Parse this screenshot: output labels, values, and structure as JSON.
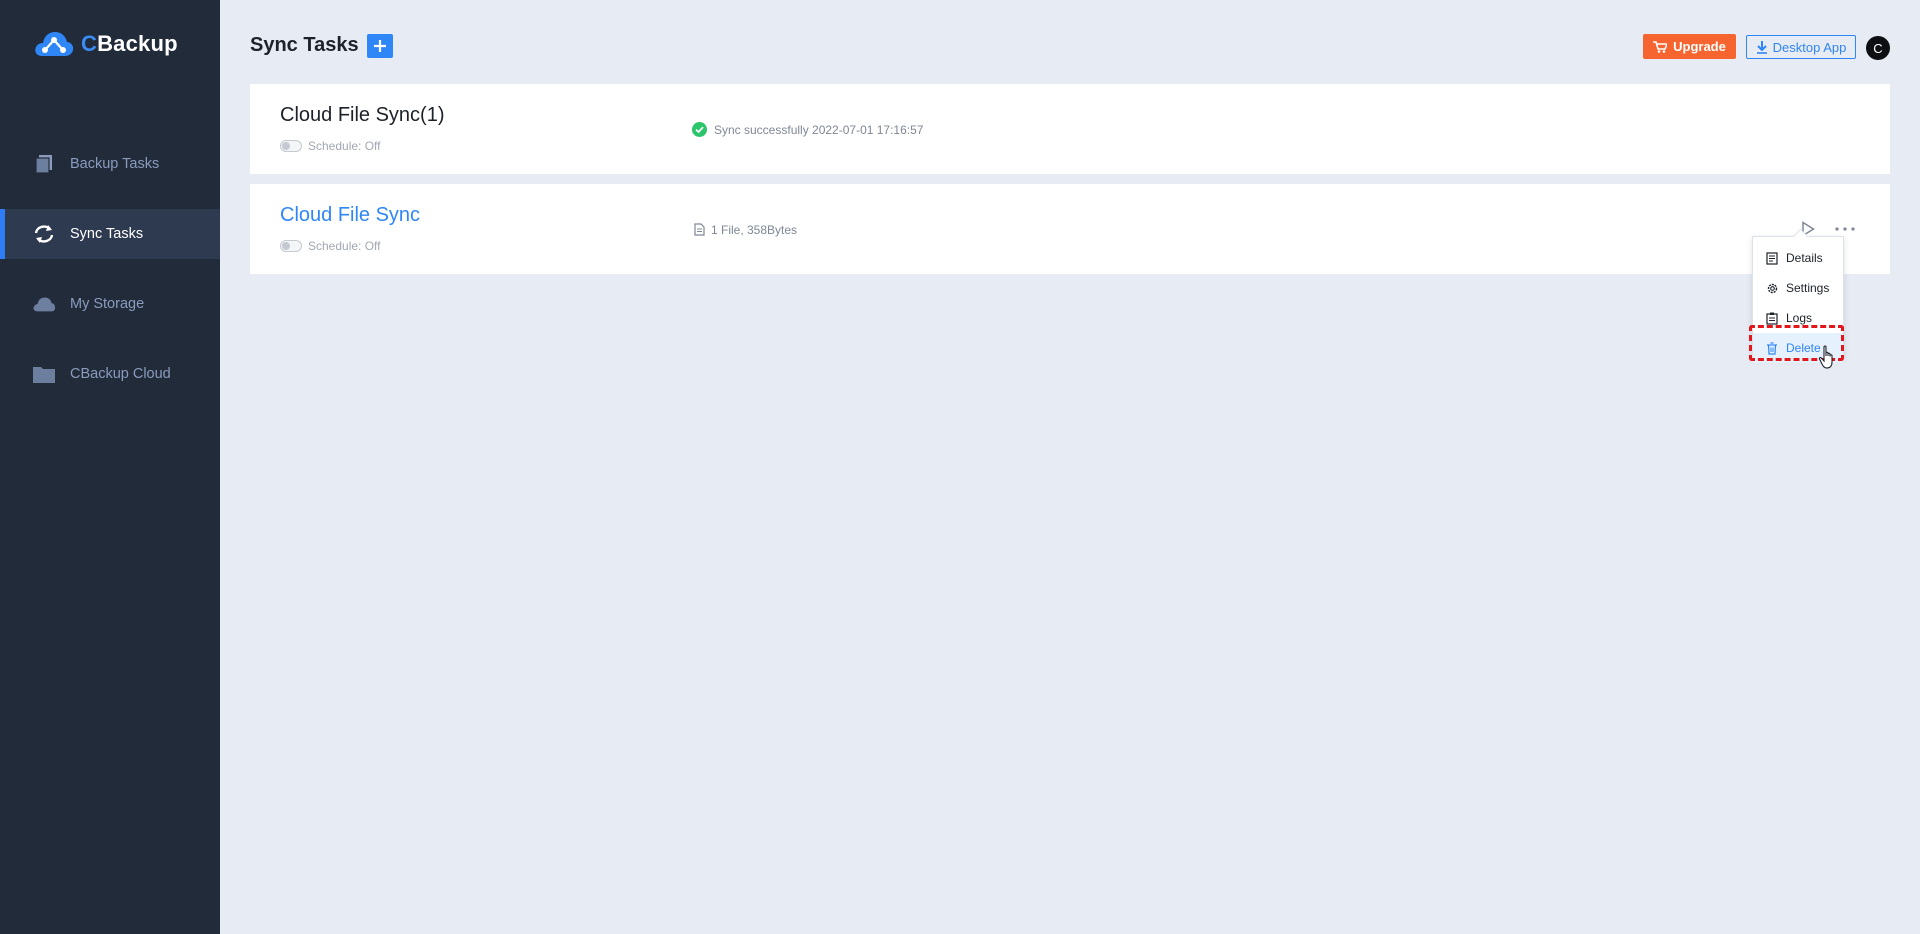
{
  "app": {
    "logo_initial": "C",
    "logo_rest": "Backup"
  },
  "sidebar": {
    "items": [
      {
        "label": "Backup Tasks",
        "icon": "backup-tasks-icon"
      },
      {
        "label": "Sync Tasks",
        "icon": "sync-icon",
        "active": true
      },
      {
        "label": "My Storage",
        "icon": "cloud-icon"
      },
      {
        "label": "CBackup Cloud",
        "icon": "folder-icon"
      }
    ]
  },
  "header": {
    "title": "Sync Tasks",
    "upgrade_label": "Upgrade",
    "desktop_app_label": "Desktop App",
    "avatar_initial": "C"
  },
  "tasks": [
    {
      "name": "Cloud File Sync(1)",
      "schedule": "Schedule: Off",
      "status_text": "Sync successfully 2022-07-01 17:16:57",
      "status_icon": "success-check-icon"
    },
    {
      "name": "Cloud File Sync",
      "schedule": "Schedule: Off",
      "status_text": "1 File, 358Bytes",
      "status_icon": "file-icon"
    }
  ],
  "context_menu": {
    "items": [
      {
        "label": "Details",
        "icon": "details-icon"
      },
      {
        "label": "Settings",
        "icon": "gear-icon"
      },
      {
        "label": "Logs",
        "icon": "clipboard-icon"
      },
      {
        "label": "Delete",
        "icon": "trash-icon",
        "highlighted": true
      }
    ]
  },
  "colors": {
    "sidebar_bg": "#222b39",
    "accent": "#2f86f6",
    "upgrade": "#f6642f",
    "success": "#2bc56b",
    "highlight_border": "#e3161b"
  }
}
